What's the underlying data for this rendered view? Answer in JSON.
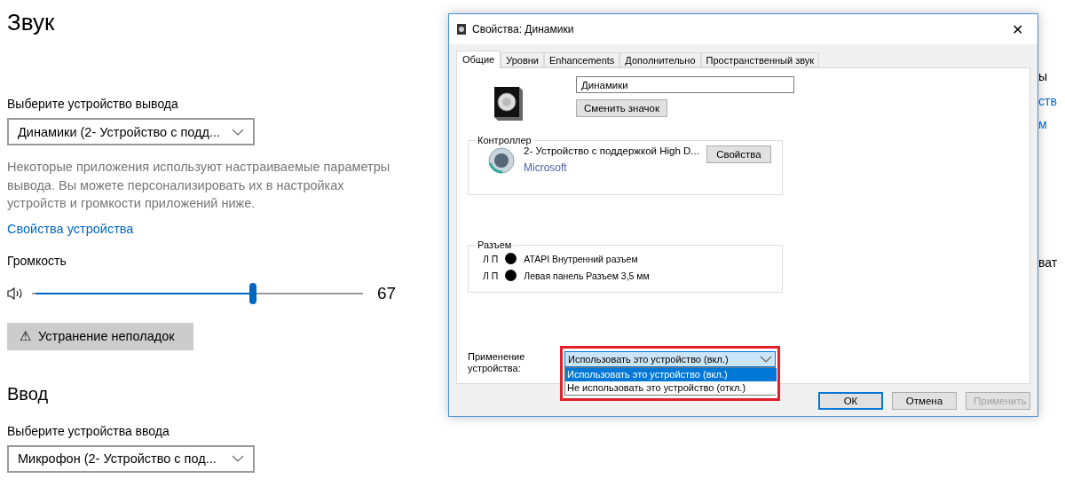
{
  "settings": {
    "title": "Звук",
    "output": {
      "label": "Выберите устройство вывода",
      "value": "Динамики (2- Устройство с подд..."
    },
    "description": "Некоторые приложения используют настраиваемые параметры вывода. Вы можете персонализировать их в настройках устройств и громкости приложений ниже.",
    "device_properties_link": "Свойства устройства",
    "volume": {
      "label": "Громкость",
      "level": 0.67,
      "reading": "67"
    },
    "troubleshoot_button": {
      "icon": "⚠",
      "label": "Устранение неполадок"
    },
    "input_heading": "Ввод",
    "input": {
      "label": "Выберите устройства ввода",
      "value": "Микрофон (2- Устройство с под..."
    }
  },
  "background_fragments": [
    {
      "text": "ы",
      "kind": "text"
    },
    {
      "text": "ств",
      "kind": "link"
    },
    {
      "text": "м",
      "kind": "link"
    },
    {
      "text": "ват",
      "kind": "text"
    }
  ],
  "dialog": {
    "title": "Свойства: Динамики",
    "close": "✕",
    "tabs": [
      {
        "label": "Общие",
        "selected": true
      },
      {
        "label": "Уровни",
        "selected": false
      },
      {
        "label": "Enhancements",
        "selected": false
      },
      {
        "label": "Дополнительно",
        "selected": false
      },
      {
        "label": "Пространственный звук",
        "selected": false
      }
    ],
    "name_field": {
      "value": "Динамики"
    },
    "change_icon_button": "Сменить значок",
    "controller": {
      "legend": "Контроллер",
      "device": "2- Устройство с поддержкой High D...",
      "vendor": "Microsoft",
      "properties_button": "Свойства"
    },
    "jack": {
      "legend": "Разъем",
      "rows": [
        {
          "channels": "Л П",
          "name": "ATAPI Внутренний разъем",
          "color": "#000000"
        },
        {
          "channels": "Л П",
          "name": "Левая панель Разъем 3,5 мм",
          "color": "#000000"
        }
      ]
    },
    "usage": {
      "label": "Применение устройства:",
      "value": "Использовать это устройство (вкл.)",
      "expanded": true,
      "options": [
        {
          "label": "Использовать это устройство (вкл.)",
          "selected": true
        },
        {
          "label": "Не использовать это устройство (откл.)",
          "selected": false
        }
      ]
    },
    "buttons": [
      {
        "label": "ОК",
        "kind": "default",
        "disabled": false
      },
      {
        "label": "Отмена",
        "kind": "normal",
        "disabled": false
      },
      {
        "label": "Применить",
        "kind": "normal",
        "disabled": true
      }
    ]
  }
}
